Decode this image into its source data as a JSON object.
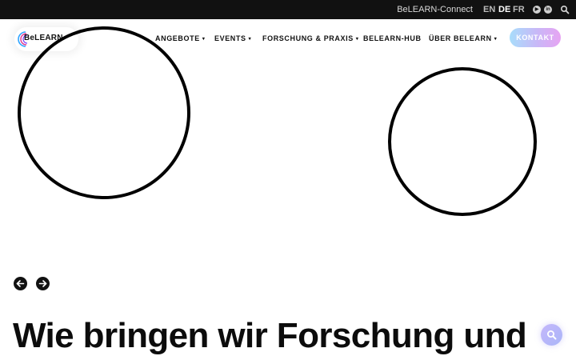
{
  "topbar": {
    "connect_link": "BeLEARN-Connect",
    "languages": [
      {
        "code": "EN",
        "active": false
      },
      {
        "code": "DE",
        "active": true
      },
      {
        "code": "FR",
        "active": false
      }
    ],
    "icons": [
      "youtube-icon",
      "linkedin-icon",
      "search-icon"
    ]
  },
  "nav": {
    "logo_text": "BeLEARN",
    "items": [
      {
        "label": "ANGEBOTE",
        "caret": "▾"
      },
      {
        "label": "EVENTS",
        "caret": "▾"
      },
      {
        "label": "FORSCHUNG & PRAXIS",
        "caret": "▾"
      },
      {
        "label": "BELEARN-HUB",
        "caret": ""
      },
      {
        "label": "ÜBER BELEARN",
        "caret": "▾"
      }
    ],
    "cta_label": "KONTAKT"
  },
  "slider": {
    "prev_icon": "arrow-left-icon",
    "next_icon": "arrow-right-icon"
  },
  "hero": {
    "headline": "Wie bringen wir Forschung und"
  },
  "colors": {
    "topbar_bg": "#111111",
    "cta_gradient_start": "#a8ddfb",
    "cta_gradient_end": "#e7a3f2",
    "fab_bg": "#c5b7fb"
  }
}
